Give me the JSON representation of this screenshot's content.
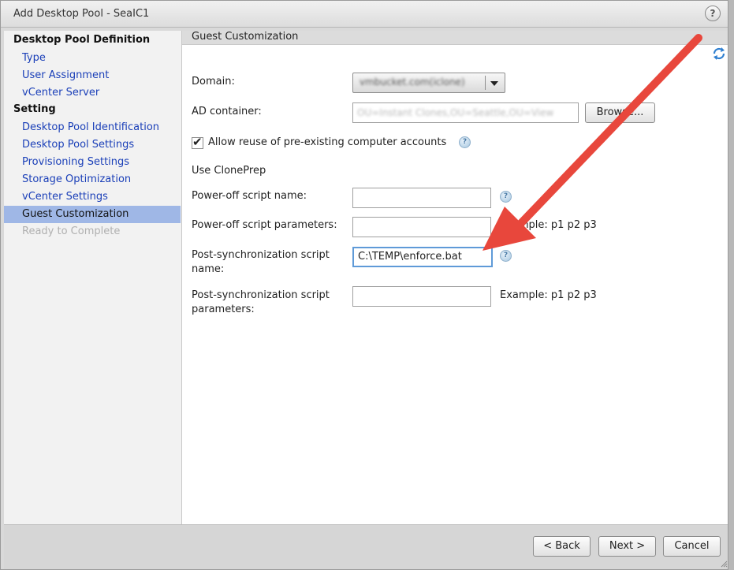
{
  "window": {
    "title": "Add Desktop Pool - SeaIC1",
    "help_label": "?"
  },
  "sidebar": {
    "section1": "Desktop Pool Definition",
    "section1_items": [
      "Type",
      "User Assignment",
      "vCenter Server"
    ],
    "section2": "Setting",
    "section2_items": [
      "Desktop Pool Identification",
      "Desktop Pool Settings",
      "Provisioning Settings",
      "Storage Optimization",
      "vCenter Settings",
      "Guest Customization",
      "Ready to Complete"
    ],
    "active_item": "Guest Customization",
    "disabled_item": "Ready to Complete"
  },
  "content": {
    "header": "Guest Customization",
    "domain_label": "Domain:",
    "domain_value": "vmbucket.com(iclone)",
    "ad_container_label": "AD container:",
    "ad_container_value": "OU=Instant Clones,OU=Seattle,OU=View",
    "browse_label": "Browse...",
    "allow_reuse_label": "Allow reuse of pre-existing computer accounts",
    "allow_reuse_checked": true,
    "use_cloneprep_label": "Use ClonePrep",
    "poweroff_name_label": "Power-off script name:",
    "poweroff_name_value": "",
    "poweroff_params_label": "Power-off script parameters:",
    "poweroff_params_value": "",
    "postsync_name_label_1": "Post-synchronization script",
    "postsync_name_label_2": "name:",
    "postsync_name_value": "C:\\TEMP\\enforce.bat",
    "postsync_params_label_1": "Post-synchronization script",
    "postsync_params_label_2": "parameters:",
    "postsync_params_value": "",
    "example_text": "Example: p1 p2 p3"
  },
  "footer": {
    "back_label": "< Back",
    "next_label": "Next >",
    "cancel_label": "Cancel"
  },
  "colors": {
    "active_nav": "#9fb7e6",
    "link": "#1a3fb8",
    "annotation_arrow": "#e8473c",
    "focus": "#5f9ad8"
  },
  "icons": [
    "help-icon",
    "refresh-icon",
    "question-icon",
    "checkmark-icon",
    "dropdown-arrow-icon",
    "resize-grip-icon"
  ]
}
